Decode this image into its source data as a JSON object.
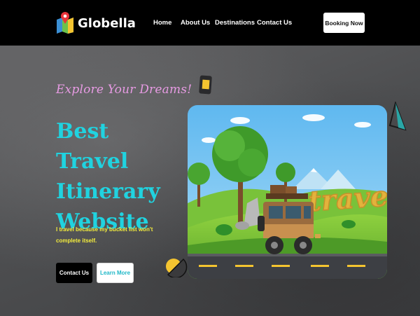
{
  "brand": {
    "name": "Globella",
    "logo_icon": "map-pin-icon"
  },
  "nav": {
    "items": [
      {
        "label": "Home"
      },
      {
        "label": "About Us"
      },
      {
        "label": "Destinations"
      },
      {
        "label": "Contact Us"
      }
    ],
    "cta_label": "Booking Now"
  },
  "hero": {
    "tagline": "Explore Your Dreams!",
    "title": "Best Travel Itinerary Website",
    "description": "I travel because my bucket list won't complete itself.",
    "primary_button": "Contact Us",
    "secondary_button": "Learn More",
    "illustration_text": "travel"
  },
  "colors": {
    "header_bg": "#000000",
    "accent_cyan": "#20d3e0",
    "tagline_pink": "#e79be3",
    "desc_yellow": "#f3ec3d",
    "page_bg": "#555658"
  }
}
